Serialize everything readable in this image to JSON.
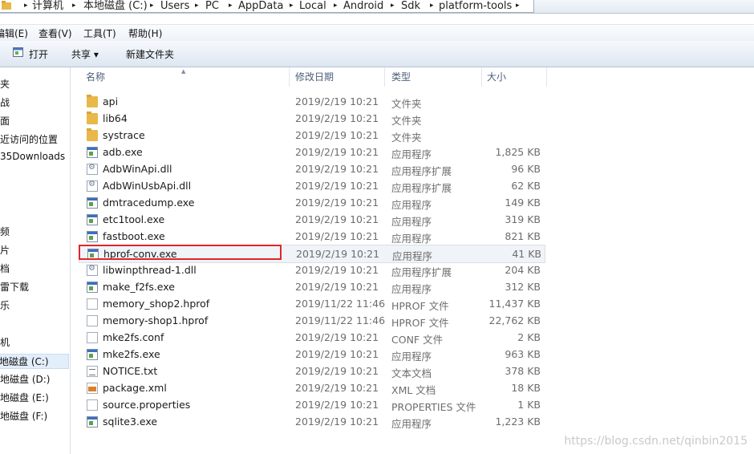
{
  "address": {
    "crumbs": [
      "计算机",
      "本地磁盘 (C:)",
      "Users",
      "PC",
      "AppData",
      "Local",
      "Android",
      "Sdk",
      "platform-tools"
    ]
  },
  "menu": [
    "编辑(E)",
    "查看(V)",
    "工具(T)",
    "帮助(H)"
  ],
  "toolbar": {
    "open": "打开",
    "share": "共享 ▾",
    "new_folder": "新建文件夹"
  },
  "nav": {
    "items": [
      "夹",
      "战",
      "面",
      "近访问的位置",
      "35Downloads",
      "",
      "",
      "频",
      "片",
      "档",
      "雷下载",
      "乐",
      "",
      "机",
      "地磁盘 (C:)",
      "地磁盘 (D:)",
      "地磁盘 (E:)",
      "地磁盘 (F:)"
    ],
    "selected_index": 14
  },
  "columns": {
    "name": "名称",
    "date": "修改日期",
    "type": "类型",
    "size": "大小"
  },
  "files": [
    {
      "name": "api",
      "date": "2019/2/19 10:21",
      "type": "文件夹",
      "size": "",
      "icon": "folder-icon"
    },
    {
      "name": "lib64",
      "date": "2019/2/19 10:21",
      "type": "文件夹",
      "size": "",
      "icon": "folder-icon"
    },
    {
      "name": "systrace",
      "date": "2019/2/19 10:21",
      "type": "文件夹",
      "size": "",
      "icon": "folder-icon"
    },
    {
      "name": "adb.exe",
      "date": "2019/2/19 10:21",
      "type": "应用程序",
      "size": "1,825 KB",
      "icon": "exe-icon"
    },
    {
      "name": "AdbWinApi.dll",
      "date": "2019/2/19 10:21",
      "type": "应用程序扩展",
      "size": "96 KB",
      "icon": "dll-icon"
    },
    {
      "name": "AdbWinUsbApi.dll",
      "date": "2019/2/19 10:21",
      "type": "应用程序扩展",
      "size": "62 KB",
      "icon": "dll-icon"
    },
    {
      "name": "dmtracedump.exe",
      "date": "2019/2/19 10:21",
      "type": "应用程序",
      "size": "149 KB",
      "icon": "exe-icon"
    },
    {
      "name": "etc1tool.exe",
      "date": "2019/2/19 10:21",
      "type": "应用程序",
      "size": "319 KB",
      "icon": "exe-icon"
    },
    {
      "name": "fastboot.exe",
      "date": "2019/2/19 10:21",
      "type": "应用程序",
      "size": "821 KB",
      "icon": "exe-icon"
    },
    {
      "name": "hprof-conv.exe",
      "date": "2019/2/19 10:21",
      "type": "应用程序",
      "size": "41 KB",
      "icon": "exe-icon"
    },
    {
      "name": "libwinpthread-1.dll",
      "date": "2019/2/19 10:21",
      "type": "应用程序扩展",
      "size": "204 KB",
      "icon": "dll-icon"
    },
    {
      "name": "make_f2fs.exe",
      "date": "2019/2/19 10:21",
      "type": "应用程序",
      "size": "312 KB",
      "icon": "exe-icon"
    },
    {
      "name": "memory_shop2.hprof",
      "date": "2019/11/22 11:46",
      "type": "HPROF 文件",
      "size": "11,437 KB",
      "icon": "file-icon"
    },
    {
      "name": "memory-shop1.hprof",
      "date": "2019/11/22 11:46",
      "type": "HPROF 文件",
      "size": "22,762 KB",
      "icon": "file-icon"
    },
    {
      "name": "mke2fs.conf",
      "date": "2019/2/19 10:21",
      "type": "CONF 文件",
      "size": "2 KB",
      "icon": "file-icon"
    },
    {
      "name": "mke2fs.exe",
      "date": "2019/2/19 10:21",
      "type": "应用程序",
      "size": "963 KB",
      "icon": "exe-icon"
    },
    {
      "name": "NOTICE.txt",
      "date": "2019/2/19 10:21",
      "type": "文本文档",
      "size": "378 KB",
      "icon": "txt-icon"
    },
    {
      "name": "package.xml",
      "date": "2019/2/19 10:21",
      "type": "XML 文档",
      "size": "18 KB",
      "icon": "xml-icon"
    },
    {
      "name": "source.properties",
      "date": "2019/2/19 10:21",
      "type": "PROPERTIES 文件",
      "size": "1 KB",
      "icon": "file-icon"
    },
    {
      "name": "sqlite3.exe",
      "date": "2019/2/19 10:21",
      "type": "应用程序",
      "size": "1,223 KB",
      "icon": "exe-icon"
    }
  ],
  "highlighted_index": 9,
  "watermark": "https://blog.csdn.net/qinbin2015"
}
